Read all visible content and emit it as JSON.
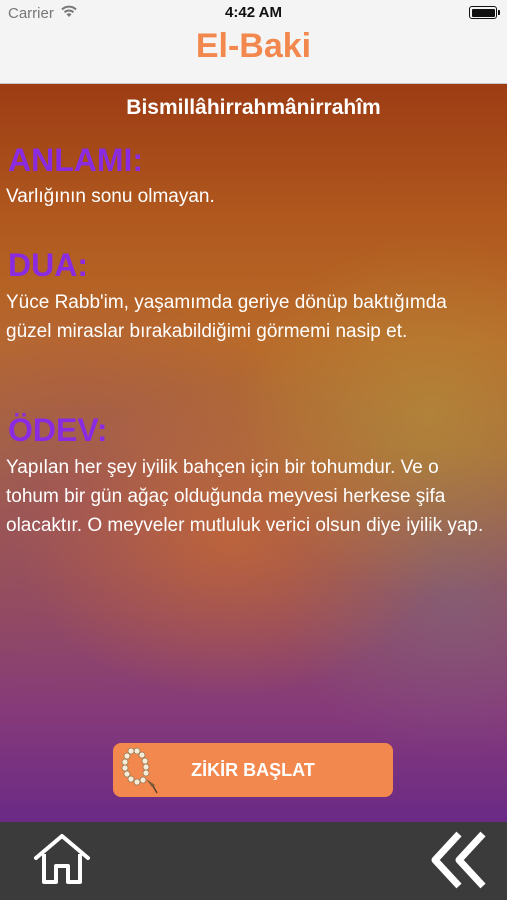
{
  "status_bar": {
    "carrier": "Carrier",
    "time": "4:42 AM",
    "wifi_icon": "wifi-icon",
    "battery_icon": "battery-icon"
  },
  "nav": {
    "title": "El-Baki"
  },
  "content": {
    "bismillah": "Bismillâhirrahmânirrahîm",
    "anlami_heading": "ANLAMI:",
    "anlami_text": "Varlığının sonu olmayan.",
    "dua_heading": "DUA:",
    "dua_text": "Yüce Rabb'im, yaşamımda geriye dönüp baktığımda güzel miraslar bırakabildiğimi görmemi nasip et.",
    "odev_heading": "ÖDEV:",
    "odev_text": "Yapılan her şey iyilik bahçen için bir tohumdur. Ve o tohum bir gün ağaç olduğunda meyvesi herkese şifa olacaktır. O meyveler mutluluk verici olsun diye iyilik yap."
  },
  "zikir_button": {
    "label": "ZİKİR BAŞLAT",
    "icon": "prayer-beads-icon"
  },
  "tab_bar": {
    "home_icon": "home-icon",
    "back_icon": "double-chevron-left-icon"
  },
  "colors": {
    "accent": "#f2884d",
    "heading": "#8a2be2",
    "tab_bar": "#3b3b3b",
    "nav_bg": "#f4f4f4"
  }
}
